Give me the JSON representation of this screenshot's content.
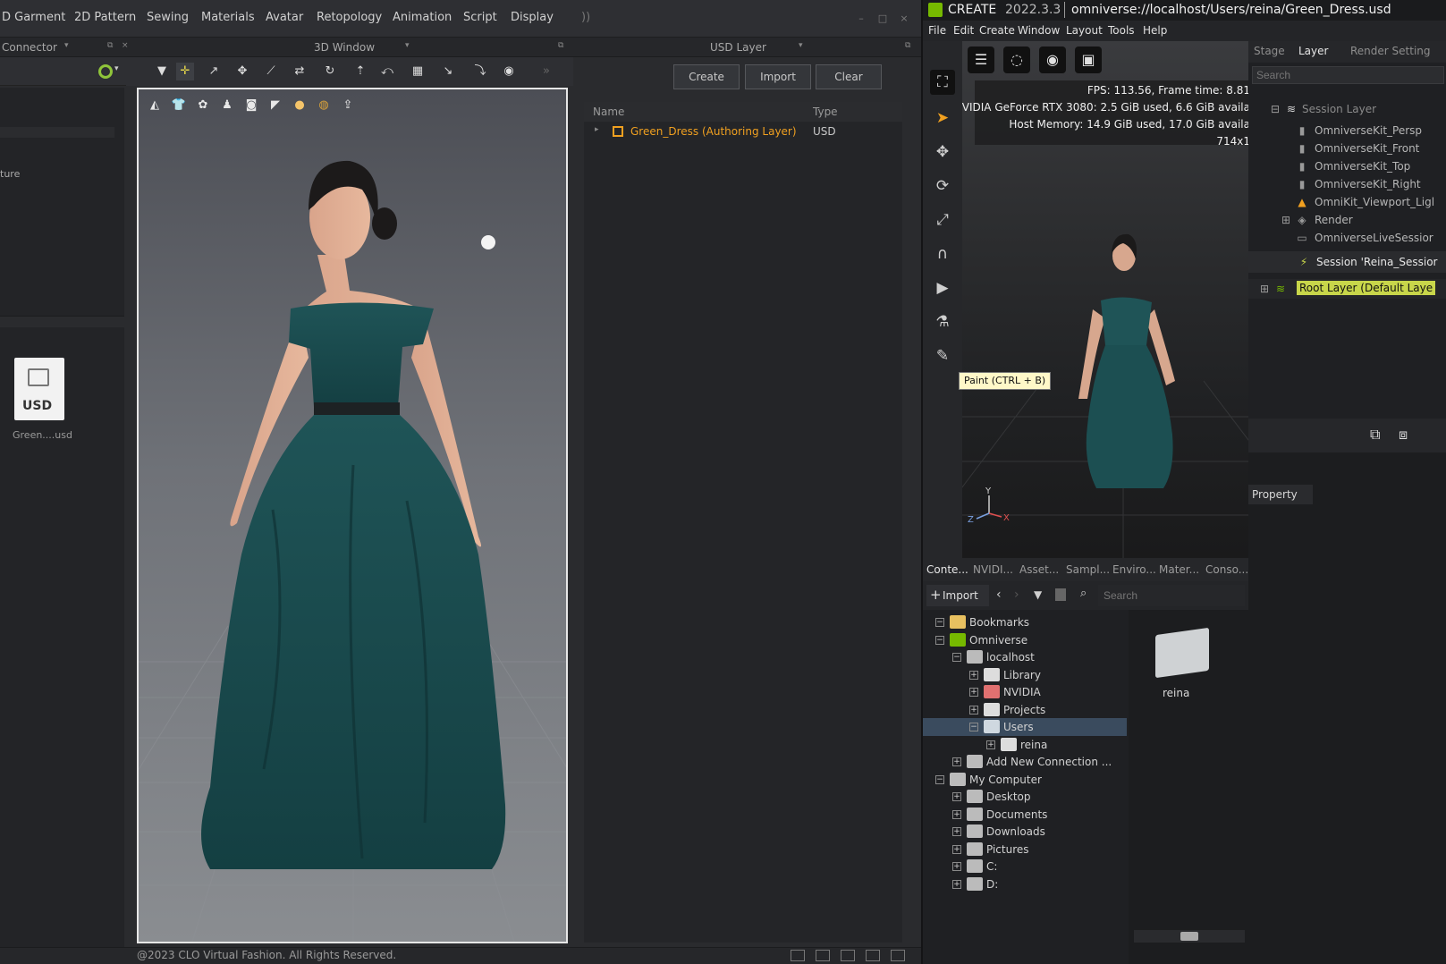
{
  "clo": {
    "menu": [
      "D Garment",
      "2D Pattern",
      "Sewing",
      "Materials",
      "Avatar",
      "Retopology",
      "Animation",
      "Script",
      "Display"
    ],
    "more_label": "))",
    "panels": {
      "connector": "Connector",
      "viewport": "3D Window",
      "usd_layer": "USD Layer"
    },
    "connector": {
      "item_partial": "ture",
      "file_label": "Green....usd",
      "file_badge": "USD"
    },
    "usd": {
      "buttons": {
        "create": "Create",
        "import": "Import",
        "clear": "Clear"
      },
      "columns": {
        "name": "Name",
        "type": "Type"
      },
      "rows": [
        {
          "name": "Green_Dress (Authoring Layer)",
          "type": "USD"
        }
      ]
    },
    "copyright": "@2023 CLO Virtual Fashion. All Rights Reserved."
  },
  "omniverse": {
    "app_name": "CREATE",
    "version": "2022.3.3",
    "file_path": "omniverse://localhost/Users/reina/Green_Dress.usd",
    "menu": [
      "File",
      "Edit",
      "Create",
      "Window",
      "Layout",
      "Tools",
      "Help"
    ],
    "stats": {
      "fps": "FPS: 113.56, Frame time: 8.81",
      "gpu": "NVIDIA GeForce RTX 3080: 2.5 GiB used, 6.6 GiB availa",
      "host": "Host Memory: 14.9 GiB used, 17.0 GiB availa",
      "res": "714x1"
    },
    "tooltip": "Paint (CTRL + B)",
    "stage_tabs": [
      "Stage",
      "Layer",
      "Render Setting"
    ],
    "search_placeholder": "Search",
    "layers": [
      {
        "label": "Session Layer",
        "indent": 0
      },
      {
        "label": "OmniverseKit_Persp",
        "indent": 1
      },
      {
        "label": "OmniverseKit_Front",
        "indent": 1
      },
      {
        "label": "OmniverseKit_Top",
        "indent": 1
      },
      {
        "label": "OmniverseKit_Right",
        "indent": 1
      },
      {
        "label": "OmniKit_Viewport_Ligl",
        "indent": 1
      },
      {
        "label": "Render",
        "indent": 1
      },
      {
        "label": "OmniverseLiveSessior",
        "indent": 1
      },
      {
        "label": "Session 'Reina_Sessior",
        "indent": 1
      },
      {
        "label": "Root Layer (Default Laye",
        "indent": 0
      }
    ],
    "property_label": "Property",
    "content_tabs": [
      "Conte...",
      "NVIDI...",
      "Asset...",
      "Sampl...",
      "Enviro...",
      "Mater...",
      "Conso..."
    ],
    "import_label": "Import",
    "content_search_placeholder": "Search",
    "tree": [
      {
        "label": "Bookmarks",
        "indent": 0,
        "exp": "−"
      },
      {
        "label": "Omniverse",
        "indent": 0,
        "exp": "−"
      },
      {
        "label": "localhost",
        "indent": 1,
        "exp": "−"
      },
      {
        "label": "Library",
        "indent": 2,
        "exp": "+"
      },
      {
        "label": "NVIDIA",
        "indent": 2,
        "exp": "+"
      },
      {
        "label": "Projects",
        "indent": 2,
        "exp": "+"
      },
      {
        "label": "Users",
        "indent": 2,
        "exp": "−"
      },
      {
        "label": "reina",
        "indent": 3,
        "exp": "+"
      },
      {
        "label": "Add New Connection ...",
        "indent": 1,
        "exp": "+"
      },
      {
        "label": "My Computer",
        "indent": 0,
        "exp": "−"
      },
      {
        "label": "Desktop",
        "indent": 1,
        "exp": "+"
      },
      {
        "label": "Documents",
        "indent": 1,
        "exp": "+"
      },
      {
        "label": "Downloads",
        "indent": 1,
        "exp": "+"
      },
      {
        "label": "Pictures",
        "indent": 1,
        "exp": "+"
      },
      {
        "label": "C:",
        "indent": 1,
        "exp": "+"
      },
      {
        "label": "D:",
        "indent": 1,
        "exp": "+"
      }
    ],
    "grid_item": "reina"
  },
  "colors": {
    "accent_orange": "#f0a020",
    "accent_yellow": "#c8d64a",
    "selection": "#3a4b5e",
    "nvidia_green": "#76b900"
  }
}
